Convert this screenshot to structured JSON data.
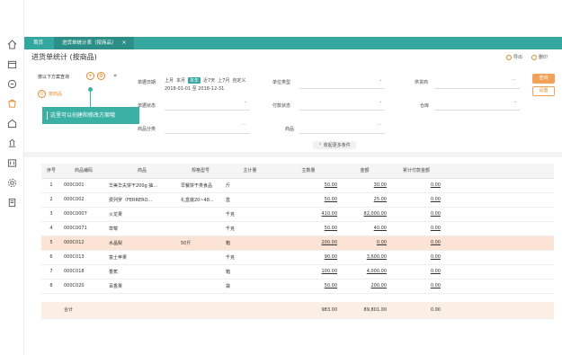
{
  "tabs": {
    "home": "首页",
    "active": "进货单统计表（按商品）",
    "close": "×"
  },
  "page": {
    "title": "进货单统计 (按商品)",
    "export": "导出",
    "print": "删印"
  },
  "plan": {
    "heading": "按以下方案查询",
    "item": "按商品",
    "tooltip": "这里可以创建和修改方案哦"
  },
  "filters": {
    "date_label": "单据日期",
    "date_buttons": [
      "上月",
      "本月",
      "本年",
      "近7天",
      "上7月",
      "自定义"
    ],
    "date_active": "本年",
    "date_range": "2018-01-01 至 2018-12-31",
    "unit_type": "单位类型",
    "supplier": "供货商",
    "doc_status": "单据状态",
    "payment_status": "付款状态",
    "warehouse": "仓库",
    "category": "商品分类",
    "product": "商品",
    "more": "收起更多条件",
    "query": "查询",
    "reset": "设置"
  },
  "table": {
    "headers": [
      "序号",
      "商品编码",
      "商品",
      "规格型号",
      "主计量",
      "主数量",
      "金额",
      "累计付款金额"
    ],
    "rows": [
      [
        "1",
        "000C001",
        "华美华夫饼干200g 抽...",
        "早餐饼干类食品",
        "斤",
        "50.00",
        "30.00",
        "0.00"
      ],
      [
        "2",
        "000C002",
        "费列罗（FERRERO...",
        "礼盒装20~48...",
        "盒",
        "50.00",
        "25.00",
        "0.00"
      ],
      [
        "3",
        "000C0007",
        "火龙果",
        "",
        "千克",
        "410.00",
        "82,000.00",
        "0.00"
      ],
      [
        "4",
        "000C0071",
        "草莓",
        "",
        "千克",
        "50.00",
        "40.00",
        "0.00"
      ],
      [
        "5",
        "000C012",
        "水晶梨",
        "50斤",
        "箱",
        "200.00",
        "0.00",
        "0.00"
      ],
      [
        "6",
        "000C013",
        "富士苹果",
        "",
        "千克",
        "90.00",
        "3,600.00",
        "0.00"
      ],
      [
        "7",
        "000C018",
        "香蕉",
        "",
        "箱",
        "100.00",
        "4,000.00",
        "0.00"
      ],
      [
        "8",
        "000C020",
        "百香果",
        "",
        "袋",
        "50.00",
        "200.00",
        "0.00"
      ]
    ],
    "highlight_row": 4,
    "total": {
      "label": "合计",
      "qty": "983.00",
      "amount": "89,801.00",
      "paid": "0.00"
    }
  },
  "colors": {
    "brand": "#34a8a0",
    "accent": "#e38a2c",
    "highlight": "#fbe4d5"
  }
}
